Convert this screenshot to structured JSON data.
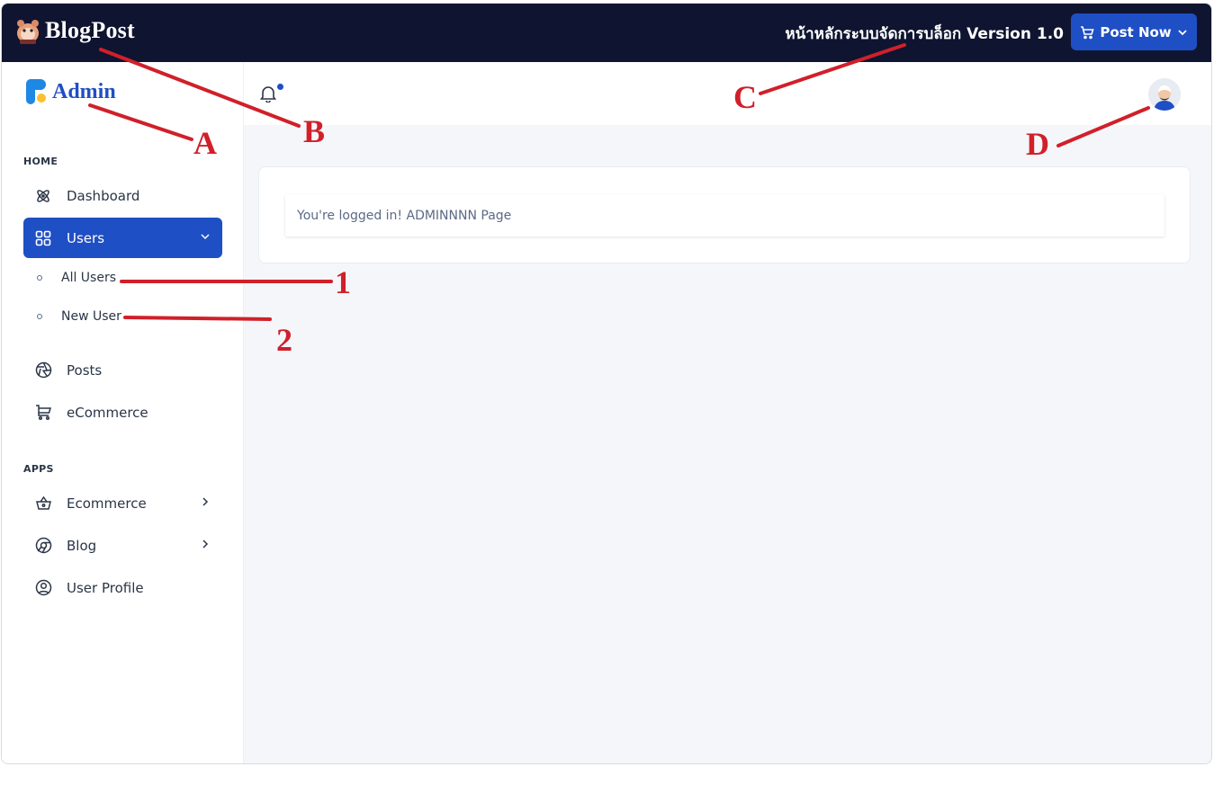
{
  "topbar": {
    "brand": "BlogPost",
    "title": "หน้าหลักระบบจัดการบล็อก Version 1.0",
    "post_button": "Post Now"
  },
  "sidebar": {
    "logo_text": "Admin",
    "home_caption": "HOME",
    "apps_caption": "APPS",
    "items": [
      {
        "label": "Dashboard",
        "icon": "atom-icon"
      },
      {
        "label": "Users",
        "icon": "grid-icon",
        "active": true
      },
      {
        "label": "Posts",
        "icon": "aperture-icon"
      },
      {
        "label": "eCommerce",
        "icon": "cart-icon"
      }
    ],
    "sub_items": [
      {
        "label": "All Users"
      },
      {
        "label": "New User"
      }
    ],
    "apps": [
      {
        "label": "Ecommerce",
        "icon": "basket-icon"
      },
      {
        "label": "Blog",
        "icon": "chrome-icon"
      },
      {
        "label": "User Profile",
        "icon": "user-circle-icon"
      }
    ]
  },
  "main": {
    "message": "You're logged in! ADMINNNN Page"
  },
  "annotations": {
    "letters": [
      "A",
      "B",
      "C",
      "D"
    ],
    "numbers": [
      "1",
      "2"
    ],
    "color": "#d0202a"
  },
  "colors": {
    "topbar_bg": "#0f1430",
    "accent": "#1f4fc4",
    "page_bg": "#f5f6fa"
  }
}
